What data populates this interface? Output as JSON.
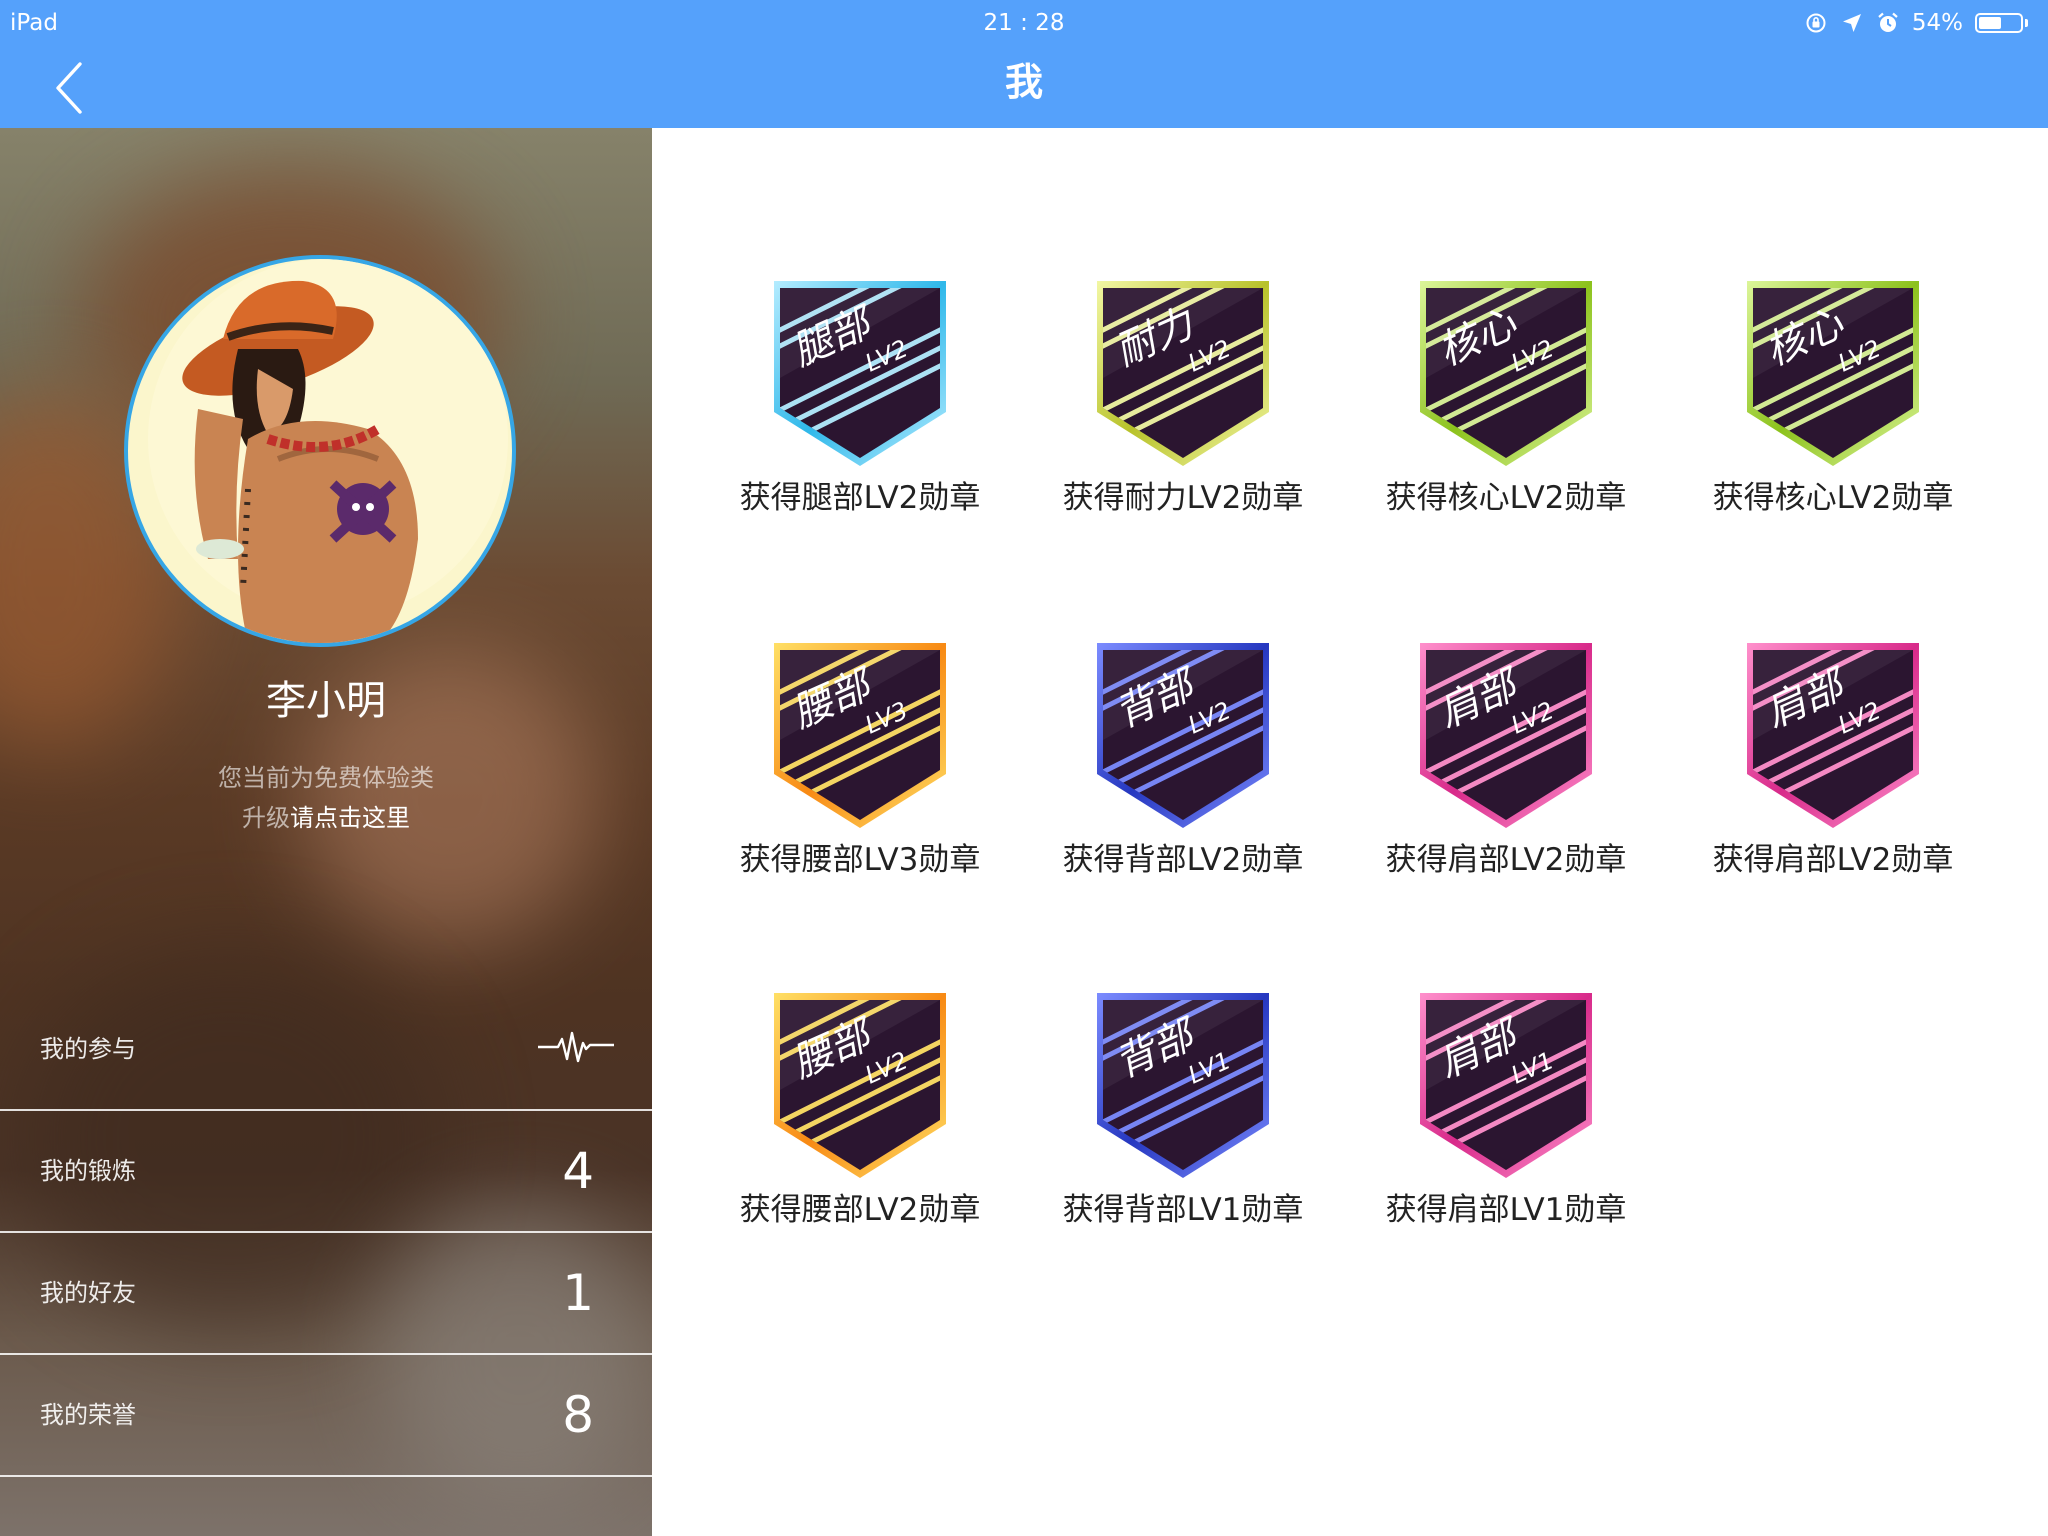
{
  "status_bar": {
    "device": "iPad",
    "time": "21 : 28",
    "battery_text": "54%",
    "battery_level": 0.54,
    "icons": [
      "orientation-lock-icon",
      "location-arrow-icon",
      "alarm-icon",
      "battery-icon"
    ]
  },
  "header": {
    "title": "我",
    "back_icon": "chevron-left-icon",
    "background": "#55a1fb"
  },
  "profile": {
    "name": "李小明",
    "membership_note": "您当前为免费体验类",
    "upgrade_prefix": "升级",
    "upgrade_link": "请点击这里"
  },
  "menu": [
    {
      "label": "我的参与",
      "value": null,
      "icon": "heartbeat-pulse-icon"
    },
    {
      "label": "我的锻炼",
      "value": "4"
    },
    {
      "label": "我的好友",
      "value": "1"
    },
    {
      "label": "我的荣誉",
      "value": "8"
    }
  ],
  "badges": [
    {
      "part": "腿部",
      "level": "LV2",
      "label": "获得腿部LV2勋章",
      "color": "#2fb8ea",
      "color_light": "#b4ecff"
    },
    {
      "part": "耐力",
      "level": "LV2",
      "label": "获得耐力LV2勋章",
      "color": "#b8c22a",
      "color_light": "#f2f7a4"
    },
    {
      "part": "核心",
      "level": "LV2",
      "label": "获得核心LV2勋章",
      "color": "#8cc21c",
      "color_light": "#dcf59a"
    },
    {
      "part": "核心",
      "level": "LV2",
      "label": "获得核心LV2勋章",
      "color": "#8cc21c",
      "color_light": "#dcf59a"
    },
    {
      "part": "腰部",
      "level": "LV3",
      "label": "获得腰部LV3勋章",
      "color": "#f88a14",
      "color_light": "#ffe066"
    },
    {
      "part": "背部",
      "level": "LV2",
      "label": "获得背部LV2勋章",
      "color": "#2638c0",
      "color_light": "#7c8cff"
    },
    {
      "part": "肩部",
      "level": "LV2",
      "label": "获得肩部LV2勋章",
      "color": "#d82a8a",
      "color_light": "#ff90cc"
    },
    {
      "part": "肩部",
      "level": "LV2",
      "label": "获得肩部LV2勋章",
      "color": "#d82a8a",
      "color_light": "#ff90cc"
    },
    {
      "part": "腰部",
      "level": "LV2",
      "label": "获得腰部LV2勋章",
      "color": "#f88a14",
      "color_light": "#ffe066"
    },
    {
      "part": "背部",
      "level": "LV1",
      "label": "获得背部LV1勋章",
      "color": "#2638c0",
      "color_light": "#7c8cff"
    },
    {
      "part": "肩部",
      "level": "LV1",
      "label": "获得肩部LV1勋章",
      "color": "#d82a8a",
      "color_light": "#ff90cc"
    }
  ]
}
